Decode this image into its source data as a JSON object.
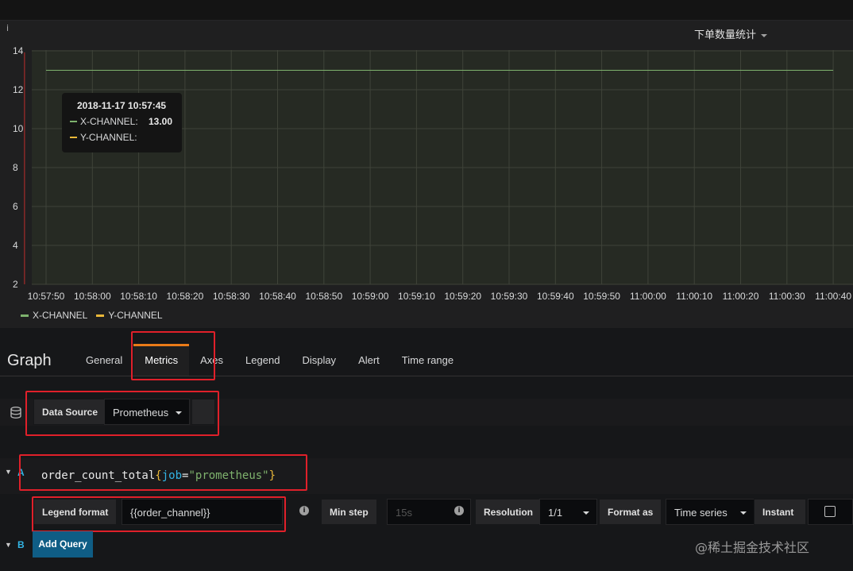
{
  "panel": {
    "info_icon": "i",
    "title": "下单数量统计"
  },
  "tooltip": {
    "time": "2018-11-17 10:57:45",
    "rows": [
      {
        "name": "X-CHANNEL:",
        "value": "13.00",
        "color": "#7eb26d"
      },
      {
        "name": "Y-CHANNEL:",
        "value": "",
        "color": "#eab839"
      }
    ]
  },
  "legend": [
    {
      "name": "X-CHANNEL",
      "color": "#7eb26d"
    },
    {
      "name": "Y-CHANNEL",
      "color": "#eab839"
    }
  ],
  "chart_data": {
    "type": "line",
    "y_ticks": [
      "14",
      "12",
      "10",
      "8",
      "6",
      "4",
      "2"
    ],
    "ylim": [
      2,
      14
    ],
    "x_ticks": [
      "10:57:50",
      "10:58:00",
      "10:58:10",
      "10:58:20",
      "10:58:30",
      "10:58:40",
      "10:58:50",
      "10:59:00",
      "10:59:10",
      "10:59:20",
      "10:59:30",
      "10:59:40",
      "10:59:50",
      "11:00:00",
      "11:00:10",
      "11:00:20",
      "11:00:30",
      "11:00:40"
    ],
    "grid": true,
    "series": [
      {
        "name": "X-CHANNEL",
        "color": "#7eb26d",
        "x": [
          "10:57:50",
          "11:00:40"
        ],
        "y": [
          13,
          13
        ]
      }
    ],
    "cursor_time": "10:57:45"
  },
  "editor": {
    "title": "Graph",
    "tabs": [
      "General",
      "Metrics",
      "Axes",
      "Legend",
      "Display",
      "Alert",
      "Time range"
    ],
    "active_tab": "Metrics"
  },
  "datasource": {
    "label": "Data Source",
    "value": "Prometheus"
  },
  "query_a": {
    "letter": "A",
    "expr_metric": "order_count_total",
    "expr_open": "{",
    "expr_key": "job",
    "expr_eq": "=",
    "expr_val": "\"prometheus\"",
    "expr_close": "}"
  },
  "options": {
    "legend_format_label": "Legend format",
    "legend_format_value": "{{order_channel}}",
    "min_step_label": "Min step",
    "min_step_placeholder": "15s",
    "resolution_label": "Resolution",
    "resolution_value": "1/1",
    "format_as_label": "Format as",
    "format_as_value": "Time series",
    "instant_label": "Instant",
    "info_glyph": "i"
  },
  "query_b": {
    "letter": "B",
    "add_query_label": "Add Query"
  },
  "watermark": "@稀土掘金技术社区",
  "colors": {
    "highlight": "#e0202a",
    "active_tab_accent": "#eb7b18",
    "query_letter": "#33b5e5",
    "add_query_bg": "#0f5d85"
  }
}
